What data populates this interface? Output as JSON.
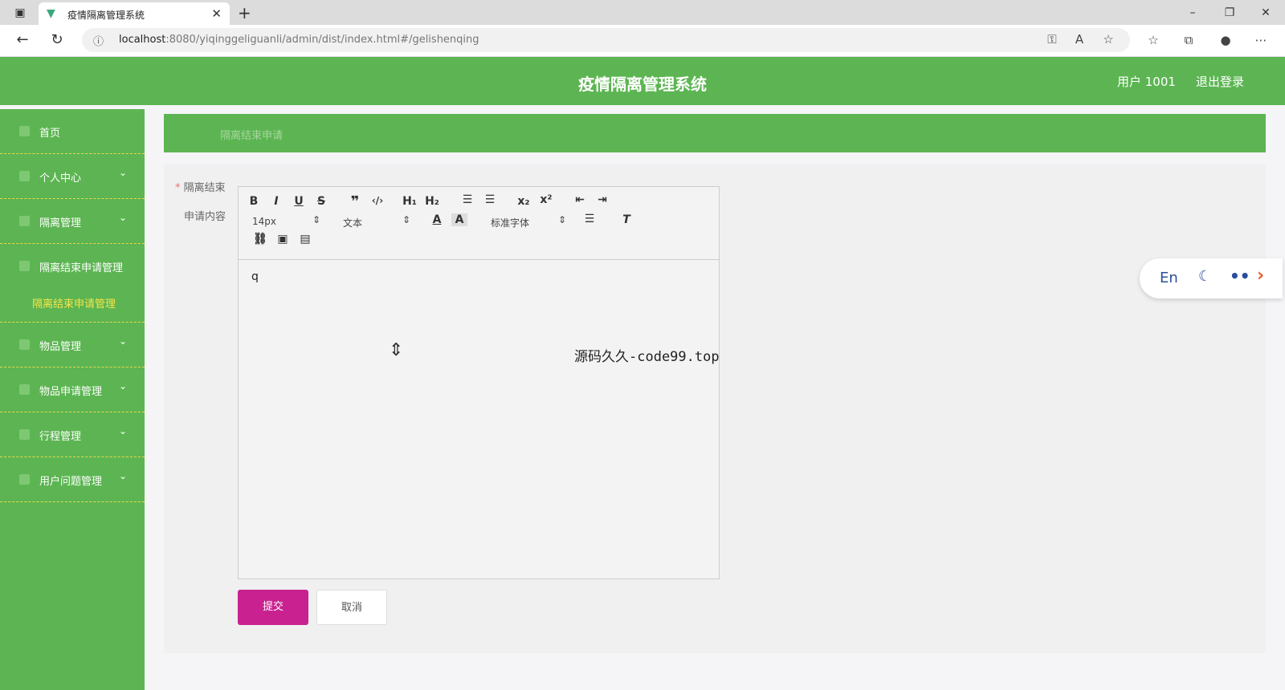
{
  "browser": {
    "tab_title": "疫情隔离管理系统",
    "tab_close": "✕",
    "new_tab": "+",
    "url_host": "localhost",
    "url_rest": ":8080/yiqinggeliguanli/admin/dist/index.html#/gelishenqing"
  },
  "header": {
    "title": "疫情隔离管理系统",
    "user": "用户 1001",
    "logout": "退出登录"
  },
  "sidebar": {
    "items": [
      {
        "label": "首页"
      },
      {
        "label": "个人中心"
      },
      {
        "label": "隔离管理"
      },
      {
        "label": "隔离结束申请管理"
      },
      {
        "label": "物品管理"
      },
      {
        "label": "物品申请管理"
      },
      {
        "label": "行程管理"
      },
      {
        "label": "用户问题管理"
      }
    ],
    "sub_item": "隔离结束申请管理"
  },
  "breadcrumb": "隔离结束申请",
  "form": {
    "label_end": "隔离结束",
    "label_content": "申请内容",
    "font_size": "14px",
    "paragraph": "文本",
    "font_family": "标准字体",
    "content": "q"
  },
  "buttons": {
    "submit": "提交",
    "cancel": "取消"
  },
  "watermark_center": "源码久久-code99.top",
  "lang_widget": {
    "en": "En"
  }
}
